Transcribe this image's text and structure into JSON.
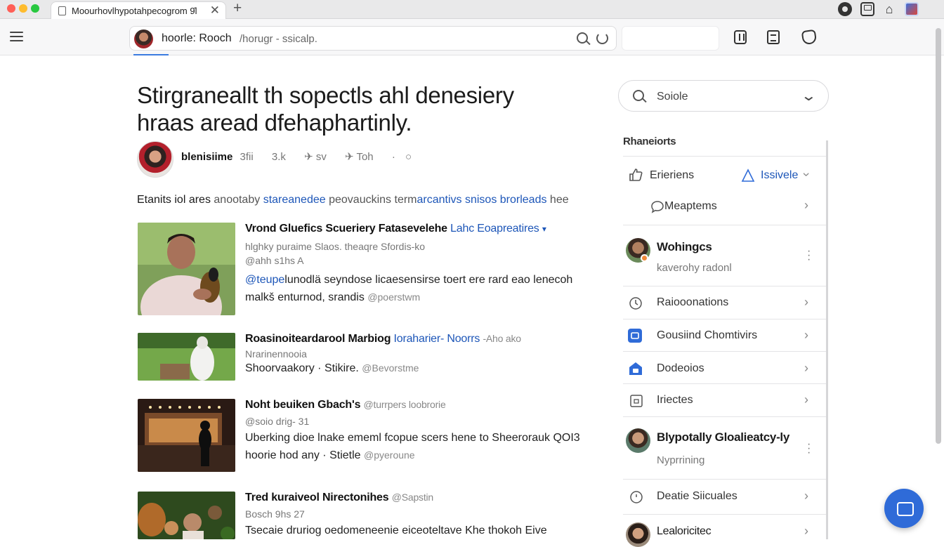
{
  "browser": {
    "tab_title": "Moourhovlhypotahpecogrom 9̂l",
    "tab_close": "✕",
    "new_tab": "+",
    "omnibox_strong": "hoorle: Rooch",
    "omnibox_rest": "/horugr - ssicalp."
  },
  "article": {
    "headline_line1": "Stirgraneallt th sopectls ahl denesiery",
    "headline_line2": "hraas aread dfehaphartinly.",
    "author": "blenisiime",
    "byline_items": [
      "3fii",
      "3.k",
      "✈ sv",
      "✈ Toh",
      "·",
      "○"
    ],
    "lead_dark": "Etanits iol ares",
    "lead_muted1": "anootaby",
    "lead_link1": "stareanedee",
    "lead_muted2": "peovauckins term",
    "lead_link2": "arcantivs snisos brorleads",
    "lead_muted3": "hee"
  },
  "feed": [
    {
      "title_bold": "Vrond Gluefics Scueriery Fatasevelehe",
      "title_link": "Lahc Eoapreatires",
      "title_caret": "▾",
      "meta1": "hlghky puraime  Slaos. theaqre  Sfordis-ko",
      "meta2": "@ahh  s1hs A",
      "body_link": "@teupe",
      "body1": "lunodlä seyndose licaesensirse toert ere rard eao lenecoh",
      "body2": "malkš enturnod, srandis",
      "body2_muted": "@poerstwm"
    },
    {
      "title_bold": "Roasinoiteardarool Marbiog",
      "title_link": "Ioraharier- Noorrs",
      "title_muted": "-Aho ako",
      "meta1": "Nrarinennooia",
      "body1": "Shoorvaakory · Stikire.",
      "body1_muted": "@Bevorstme"
    },
    {
      "title_bold": "Noht beuiken Gbach's",
      "title_muted": "@turrpers loobrorie",
      "meta1": "@soio  drig- 31",
      "body1": "Uberking dioe lnake ememl fcopue scers hene to Sheerorauk QOI3",
      "body2": "hoorie hod any · Stietle",
      "body2_muted": "@pyeroune"
    },
    {
      "title_bold": "Tred kuraiveol Nirectonihes",
      "title_muted": "@Sapstin",
      "meta1": "Bosch  9hs 27",
      "body1": "Tsecaie druriog oedomeneenie eiceoteltave Khe thokoh Eive"
    }
  ],
  "sidebar": {
    "search_placeholder": "Soiole",
    "heading": "Rhaneiorts",
    "row_endorsements": {
      "label": "Erieriens",
      "action": "Issivele"
    },
    "row_mentions": "Meaptems",
    "user1": {
      "name": "Wohingcs",
      "sub": "kaverohy radonl"
    },
    "rows": [
      "Raiooonations",
      "Gousiind Chomtivirs",
      "Dodeoios",
      "Iriectes"
    ],
    "user2": {
      "name": "Blypotally Gloalieatcy-ly",
      "sub": "Nyprrining"
    },
    "row_last": "Deatie Siicuales",
    "user3": "Lealoricitec"
  },
  "icons": {
    "tab_favicon": "page-icon",
    "menu": "hamburger-icon",
    "omnibox_search": "search-icon",
    "omnibox_reload": "reload-icon",
    "chat": "chat-icon"
  },
  "colors": {
    "link": "#1d56b8",
    "accent": "#2f6bd8"
  }
}
